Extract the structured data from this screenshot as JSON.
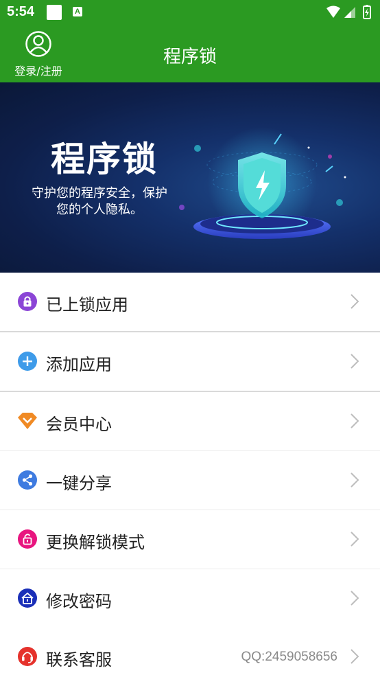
{
  "status_bar": {
    "time": "5:54"
  },
  "header": {
    "login_label": "登录/注册",
    "title": "程序锁"
  },
  "banner": {
    "title": "程序锁",
    "subtitle": "守护您的程序安全，保护您的个人隐私。"
  },
  "menu": {
    "items": [
      {
        "label": "已上锁应用",
        "icon": "lock-icon",
        "color": "#8b45d6"
      },
      {
        "label": "添加应用",
        "icon": "add-icon",
        "color": "#3e9be9"
      },
      {
        "label": "会员中心",
        "icon": "diamond-icon",
        "color": "#f08a24"
      },
      {
        "label": "一键分享",
        "icon": "share-icon",
        "color": "#3e7be0"
      },
      {
        "label": "更换解锁模式",
        "icon": "unlock-icon",
        "color": "#e8157f"
      },
      {
        "label": "修改密码",
        "icon": "password-lock-icon",
        "color": "#1a2fb8"
      },
      {
        "label": "联系客服",
        "icon": "headset-icon",
        "color": "#e5322c",
        "extra": "QQ:2459058656"
      }
    ]
  },
  "colors": {
    "primary": "#2b9a22"
  }
}
